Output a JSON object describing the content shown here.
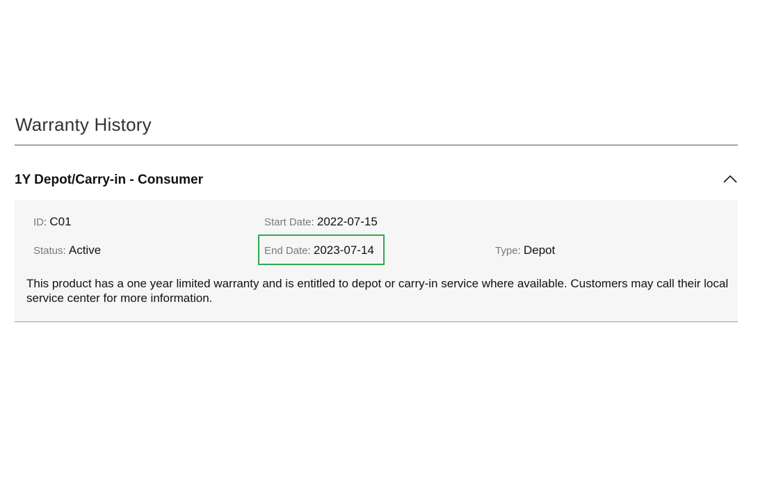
{
  "section": {
    "title": "Warranty History"
  },
  "warranty": {
    "title": "1Y Depot/Carry-in - Consumer",
    "expanded": true,
    "toggle_icon": "chevron-up-icon",
    "fields": {
      "id": {
        "label": "ID",
        "value": "C01"
      },
      "start_date": {
        "label": "Start Date",
        "value": "2022-07-15"
      },
      "status": {
        "label": "Status",
        "value": "Active"
      },
      "end_date": {
        "label": "End Date",
        "value": "2023-07-14"
      },
      "type": {
        "label": "Type",
        "value": "Depot"
      }
    },
    "description": "This product has a one year limited warranty and is entitled to depot or carry-in service where available. Customers may call their local service center for more information."
  },
  "colors": {
    "highlight": "#2ea84f",
    "panel_background": "#f6f6f6",
    "label": "#7a7a7a"
  }
}
